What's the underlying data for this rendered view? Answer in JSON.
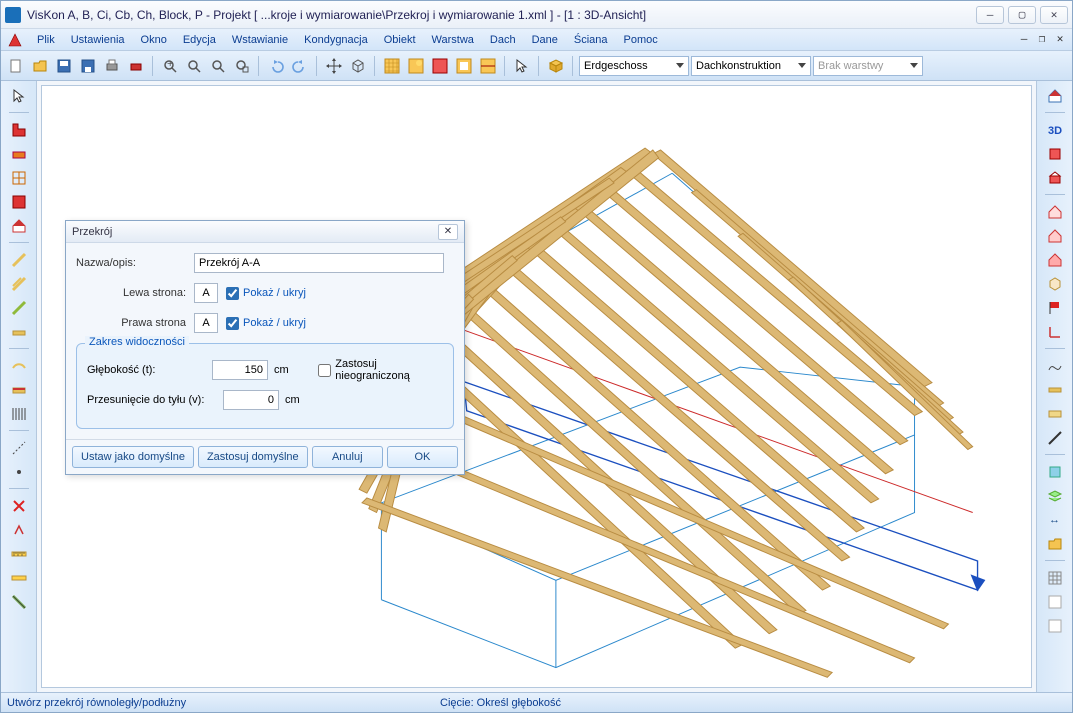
{
  "titlebar": {
    "title": "VisKon A, B, Ci, Cb, Ch, Block, P - Projekt [ ...kroje i wymiarowanie\\Przekroj i wymiarowanie 1.xml ]  - [1 : 3D-Ansicht]"
  },
  "menu": {
    "items": [
      "Plik",
      "Ustawienia",
      "Okno",
      "Edycja",
      "Wstawianie",
      "Kondygnacja",
      "Obiekt",
      "Warstwa",
      "Dach",
      "Dane",
      "Ściana",
      "Pomoc"
    ]
  },
  "toolbar": {
    "selects": {
      "floor": "Erdgeschoss",
      "construction": "Dachkonstruktion",
      "layer": "Brak warstwy"
    }
  },
  "dialog": {
    "title": "Przekrój",
    "name_label": "Nazwa/opis:",
    "name_value": "Przekrój A-A",
    "left_label": "Lewa strona:",
    "left_value": "A",
    "right_label": "Prawa strona",
    "right_value": "A",
    "show_hide": "Pokaż / ukryj",
    "fieldset_legend": "Zakres widoczności",
    "depth_label": "Głębokość (t):",
    "depth_value": "150",
    "offset_label": "Przesunięcie do tyłu (v):",
    "offset_value": "0",
    "unit": "cm",
    "unlimited_label": "Zastosuj nieograniczoną",
    "btn_set_default": "Ustaw jako domyślne",
    "btn_apply_default": "Zastosuj domyślne",
    "btn_cancel": "Anuluj",
    "btn_ok": "OK"
  },
  "statusbar": {
    "left": "Utwórz przekrój równoległy/podłużny",
    "center": "Cięcie: Określ głębokość"
  },
  "colors": {
    "accent": "#0b57bb",
    "wood": "#d8b068",
    "wood_dark": "#b88c42"
  }
}
